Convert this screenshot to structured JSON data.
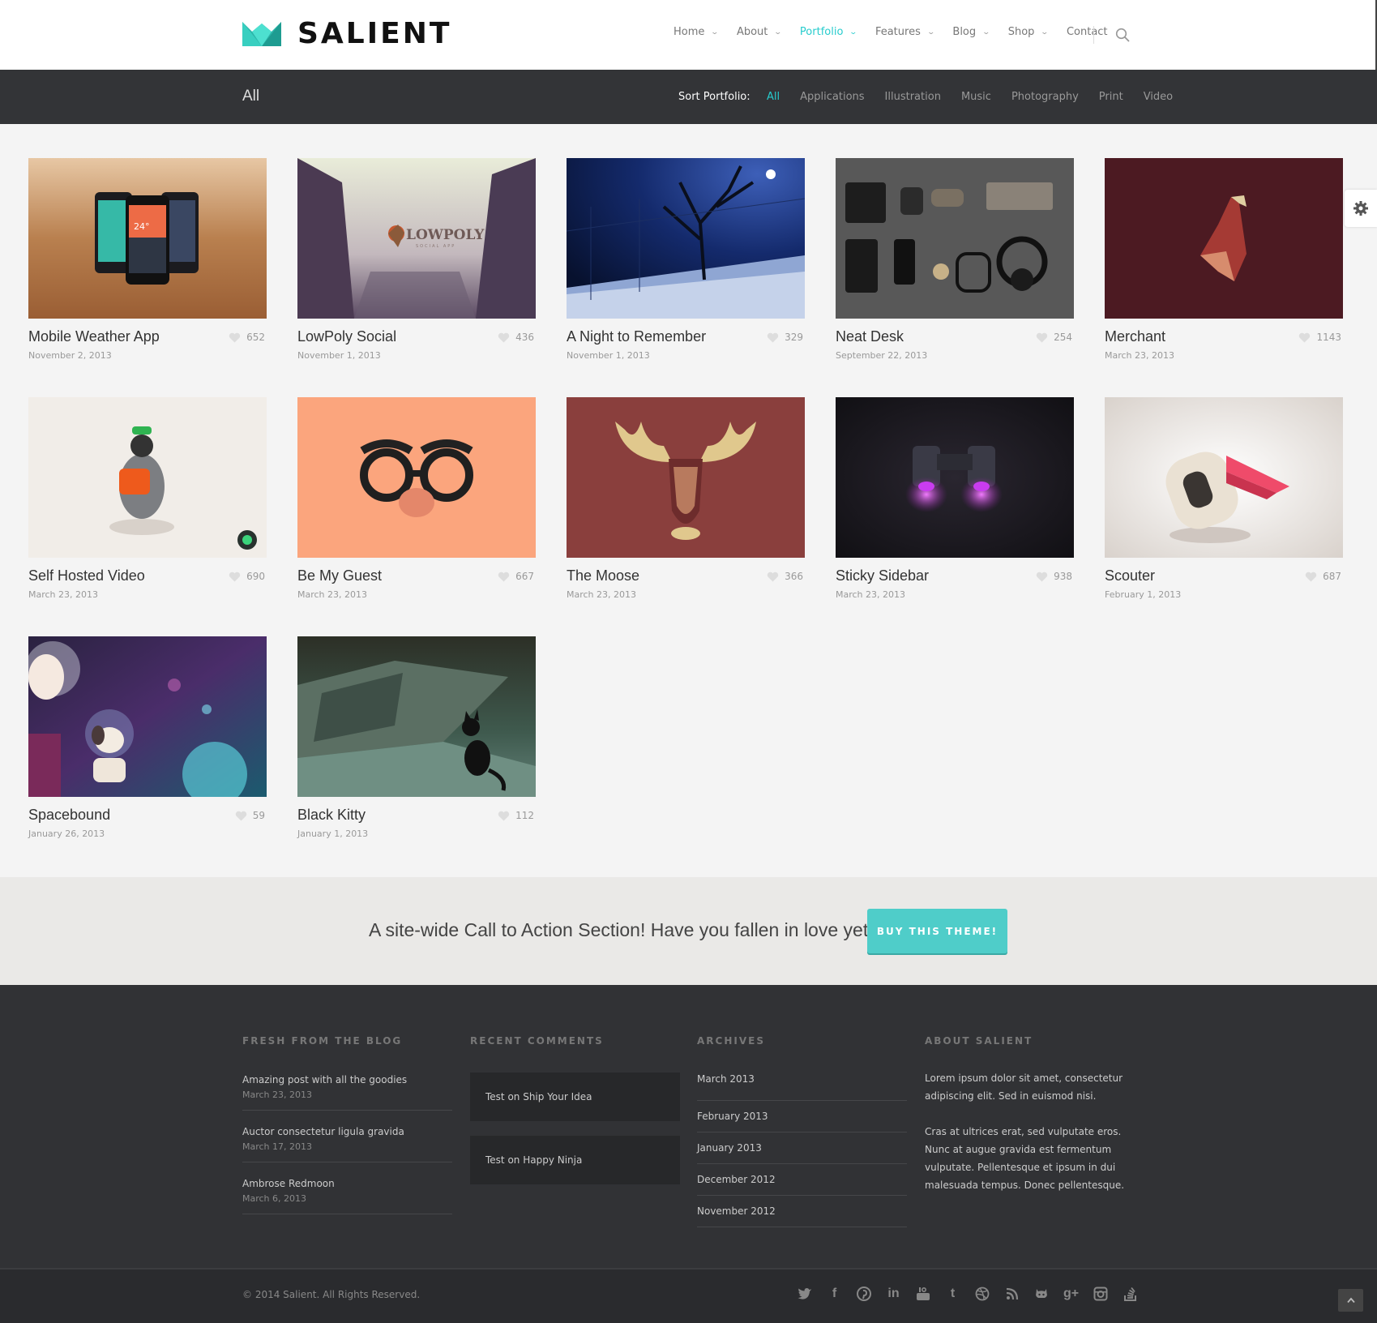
{
  "brand": {
    "name": "SALIENT",
    "accent": "#27cccd"
  },
  "nav": {
    "items": [
      {
        "label": "Home",
        "dropdown": true
      },
      {
        "label": "About",
        "dropdown": true
      },
      {
        "label": "Portfolio",
        "dropdown": true,
        "active": true
      },
      {
        "label": "Features",
        "dropdown": true
      },
      {
        "label": "Blog",
        "dropdown": true
      },
      {
        "label": "Shop",
        "dropdown": true
      },
      {
        "label": "Contact",
        "dropdown": false
      }
    ]
  },
  "portfolio": {
    "title": "All",
    "sort_label": "Sort Portfolio:",
    "filters": [
      "All",
      "Applications",
      "Illustration",
      "Music",
      "Photography",
      "Print",
      "Video"
    ],
    "active_filter": "All",
    "items": [
      {
        "title": "Mobile Weather App",
        "date": "November 2, 2013",
        "likes": "652"
      },
      {
        "title": "LowPoly Social",
        "date": "November 1, 2013",
        "likes": "436"
      },
      {
        "title": "A Night to Remember",
        "date": "November 1, 2013",
        "likes": "329"
      },
      {
        "title": "Neat Desk",
        "date": "September 22, 2013",
        "likes": "254"
      },
      {
        "title": "Merchant",
        "date": "March 23, 2013",
        "likes": "1143"
      },
      {
        "title": "Self Hosted Video",
        "date": "March 23, 2013",
        "likes": "690"
      },
      {
        "title": "Be My Guest",
        "date": "March 23, 2013",
        "likes": "667"
      },
      {
        "title": "The Moose",
        "date": "March 23, 2013",
        "likes": "366"
      },
      {
        "title": "Sticky Sidebar",
        "date": "March 23, 2013",
        "likes": "938"
      },
      {
        "title": "Scouter",
        "date": "February 1, 2013",
        "likes": "687"
      },
      {
        "title": "Spacebound",
        "date": "January 26, 2013",
        "likes": "59"
      },
      {
        "title": "Black Kitty",
        "date": "January 1, 2013",
        "likes": "112"
      }
    ]
  },
  "thumb_text": {
    "lowpoly": "LOWPOLY",
    "lowpoly_sub": "SOCIAL APP",
    "weather_temp": "24°"
  },
  "cta": {
    "text": "A site-wide Call to Action Section! Have you fallen in love yet?",
    "button": "BUY THIS THEME!"
  },
  "footer": {
    "blog": {
      "heading": "FRESH FROM THE BLOG",
      "posts": [
        {
          "title": "Amazing post with all the goodies",
          "date": "March 23, 2013"
        },
        {
          "title": "Auctor consectetur ligula gravida",
          "date": "March 17, 2013"
        },
        {
          "title": "Ambrose Redmoon",
          "date": "March 6, 2013"
        }
      ]
    },
    "comments": {
      "heading": "RECENT COMMENTS",
      "items": [
        "Test on Ship Your Idea",
        "Test on Happy Ninja"
      ]
    },
    "archives": {
      "heading": "ARCHIVES",
      "items": [
        "March 2013",
        "February 2013",
        "January 2013",
        "December 2012",
        "November 2012"
      ]
    },
    "about": {
      "heading": "ABOUT SALIENT",
      "paragraphs": [
        "Lorem ipsum dolor sit amet, consectetur adipiscing elit. Sed in euismod nisi.",
        "Cras at ultrices erat, sed vulputate eros. Nunc at augue gravida est fermentum vulputate. Pellentesque et ipsum in dui malesuada tempus. Donec pellentesque."
      ]
    },
    "copyright": "© 2014 Salient. All Rights Reserved.",
    "socials": [
      "twitter-icon",
      "facebook-icon",
      "pinterest-icon",
      "linkedin-icon",
      "youtube-icon",
      "tumblr-icon",
      "dribbble-icon",
      "rss-icon",
      "github-icon",
      "google-plus-icon",
      "instagram-icon",
      "stackexchange-icon"
    ],
    "social_glyphs": {
      "facebook": "f",
      "linkedin": "in",
      "tumblr": "t",
      "google_plus": "g+"
    }
  }
}
